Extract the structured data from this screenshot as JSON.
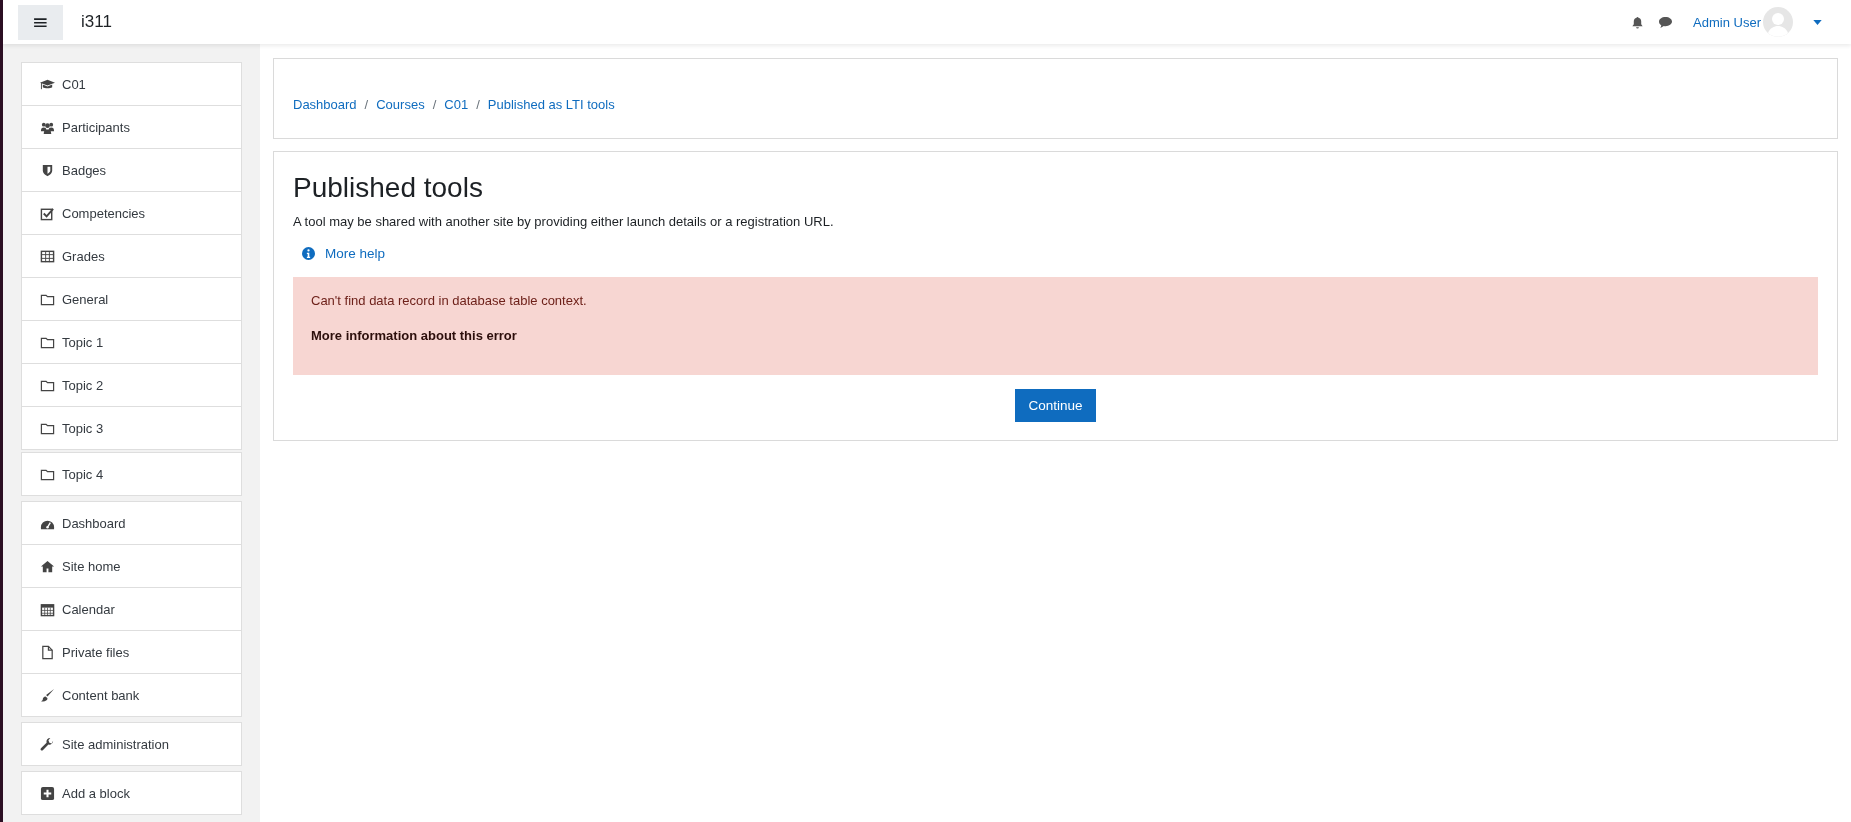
{
  "navbar": {
    "menu_icon": "≡",
    "site_name": "i311",
    "user_name": "Admin User"
  },
  "sidebar": {
    "groups": [
      {
        "items": [
          {
            "label": "C01"
          },
          {
            "label": "Participants"
          },
          {
            "label": "Badges"
          },
          {
            "label": "Competencies"
          },
          {
            "label": "Grades"
          },
          {
            "label": "General"
          },
          {
            "label": "Topic 1"
          },
          {
            "label": "Topic 2"
          },
          {
            "label": "Topic 3"
          }
        ]
      },
      {
        "items": [
          {
            "label": "Topic 4"
          }
        ]
      },
      {
        "items": [
          {
            "label": "Dashboard"
          },
          {
            "label": "Site home"
          },
          {
            "label": "Calendar"
          },
          {
            "label": "Private files"
          },
          {
            "label": "Content bank"
          }
        ]
      },
      {
        "items": [
          {
            "label": "Site administration"
          }
        ]
      },
      {
        "items": [
          {
            "label": "Add a block"
          }
        ]
      }
    ]
  },
  "breadcrumb": {
    "separator": "/",
    "items": [
      "Dashboard",
      "Courses",
      "C01",
      "Published as LTI tools"
    ]
  },
  "main": {
    "title": "Published tools",
    "description": "A tool may be shared with another site by providing either launch details or a registration URL.",
    "help_link": "More help",
    "error": {
      "message": "Can't find data record in database table context.",
      "more_info": "More information about this error"
    },
    "button": "Continue"
  }
}
